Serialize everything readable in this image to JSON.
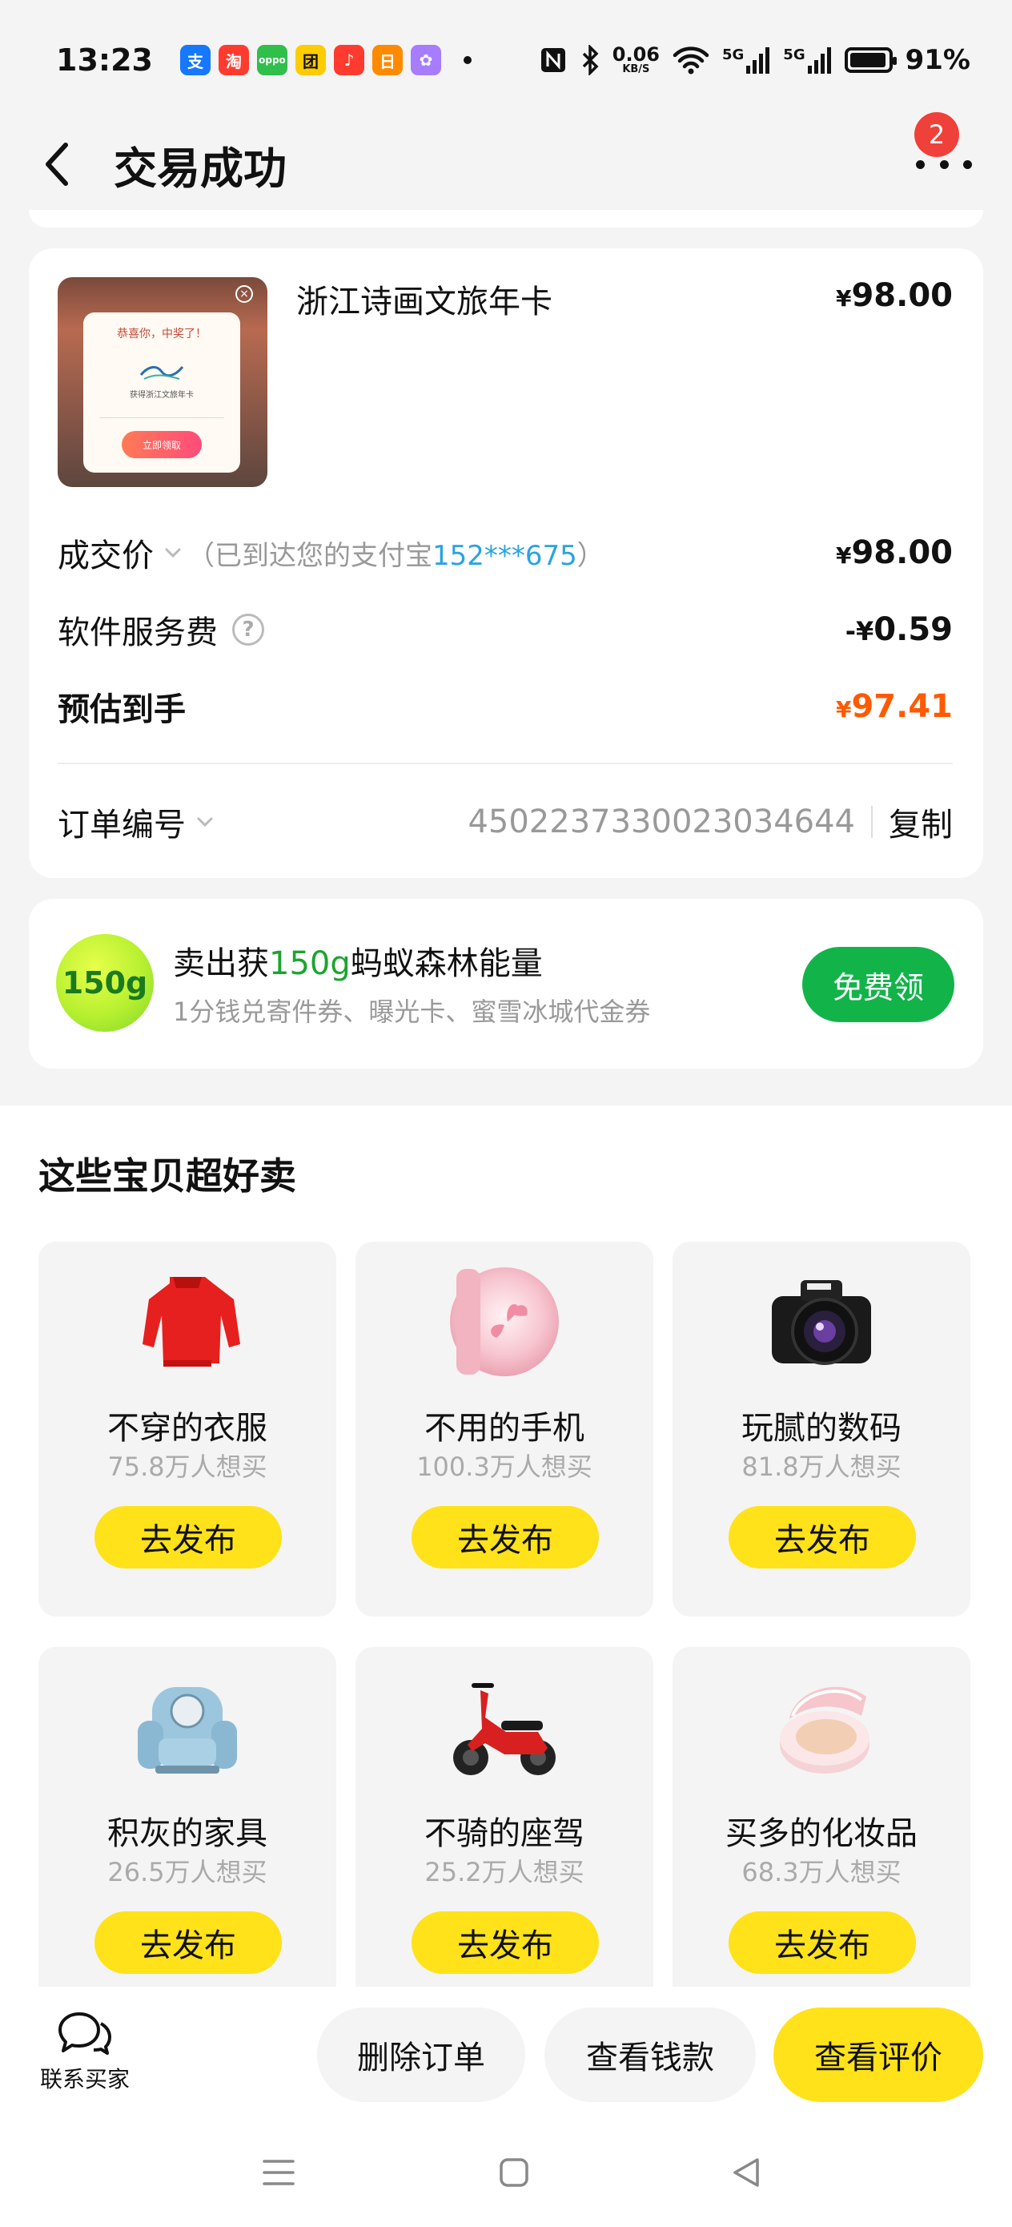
{
  "status_bar": {
    "time": "13:23",
    "net_speed_value": "0.06",
    "net_speed_unit": "KB/S",
    "signal1": "5G",
    "signal2": "5G",
    "battery": "91%",
    "app_icons": [
      {
        "name": "alipay-app-icon",
        "glyph": "支",
        "color": "#1677ff"
      },
      {
        "name": "taobao-app-icon",
        "glyph": "淘",
        "color": "#ff3b30"
      },
      {
        "name": "oppo-app-icon",
        "glyph": "oppo",
        "color": "#2fbf4a"
      },
      {
        "name": "meituan-app-icon",
        "glyph": "团",
        "color": "#ffcc00"
      },
      {
        "name": "music-app-icon",
        "glyph": "♪",
        "color": "#ff3b30"
      },
      {
        "name": "calendar-app-icon",
        "glyph": "日",
        "color": "#ff8a00"
      },
      {
        "name": "gallery-app-icon",
        "glyph": "✿",
        "color": "#a77cff"
      }
    ]
  },
  "nav": {
    "title": "交易成功",
    "badge_count": "2"
  },
  "order": {
    "product_title": "浙江诗画文旅年卡",
    "product_price_symbol": "¥",
    "product_price": "98.00",
    "product_image": {
      "popup_title": "恭喜你，中奖了！",
      "popup_sub": "获得浙江文旅年卡",
      "popup_button": "立即领取"
    },
    "deal_price_label": "成交价",
    "deal_hint_prefix": "（已到达您的支付宝",
    "deal_hint_account": "152***675",
    "deal_hint_suffix": "）",
    "deal_price_symbol": "¥",
    "deal_price": "98.00",
    "service_fee_label": "软件服务费",
    "service_fee_icon": "?",
    "service_fee_prefix": "-¥",
    "service_fee": "0.59",
    "estimate_label": "预估到手",
    "estimate_symbol": "¥",
    "estimate": "97.41",
    "order_no_label": "订单编号",
    "order_no": "4502237330023034644",
    "copy_label": "复制"
  },
  "energy": {
    "ball_text": "150g",
    "title_prefix": "卖出获",
    "title_highlight": "150g",
    "title_suffix": "蚂蚁森林能量",
    "subtitle": "1分钱兑寄件券、曝光卡、蜜雪冰城代金券",
    "button": "免费领"
  },
  "recommend": {
    "title": "这些宝贝超好卖",
    "button_label": "去发布",
    "items": [
      {
        "name": "不穿的衣服",
        "count": "75.8万人想买"
      },
      {
        "name": "不用的手机",
        "count": "100.3万人想买"
      },
      {
        "name": "玩腻的数码",
        "count": "81.8万人想买"
      },
      {
        "name": "积灰的家具",
        "count": "26.5万人想买"
      },
      {
        "name": "不骑的座驾",
        "count": "25.2万人想买"
      },
      {
        "name": "买多的化妆品",
        "count": "68.3万人想买"
      }
    ]
  },
  "actions": {
    "contact_label": "联系买家",
    "delete": "删除订单",
    "view_money": "查看钱款",
    "view_review": "查看评价"
  },
  "colors": {
    "accent_yellow": "#ffe21a",
    "price_orange": "#ff5a00",
    "energy_green": "#12b44a",
    "account_blue": "#2aa3e0",
    "badge_red": "#f0403a"
  }
}
